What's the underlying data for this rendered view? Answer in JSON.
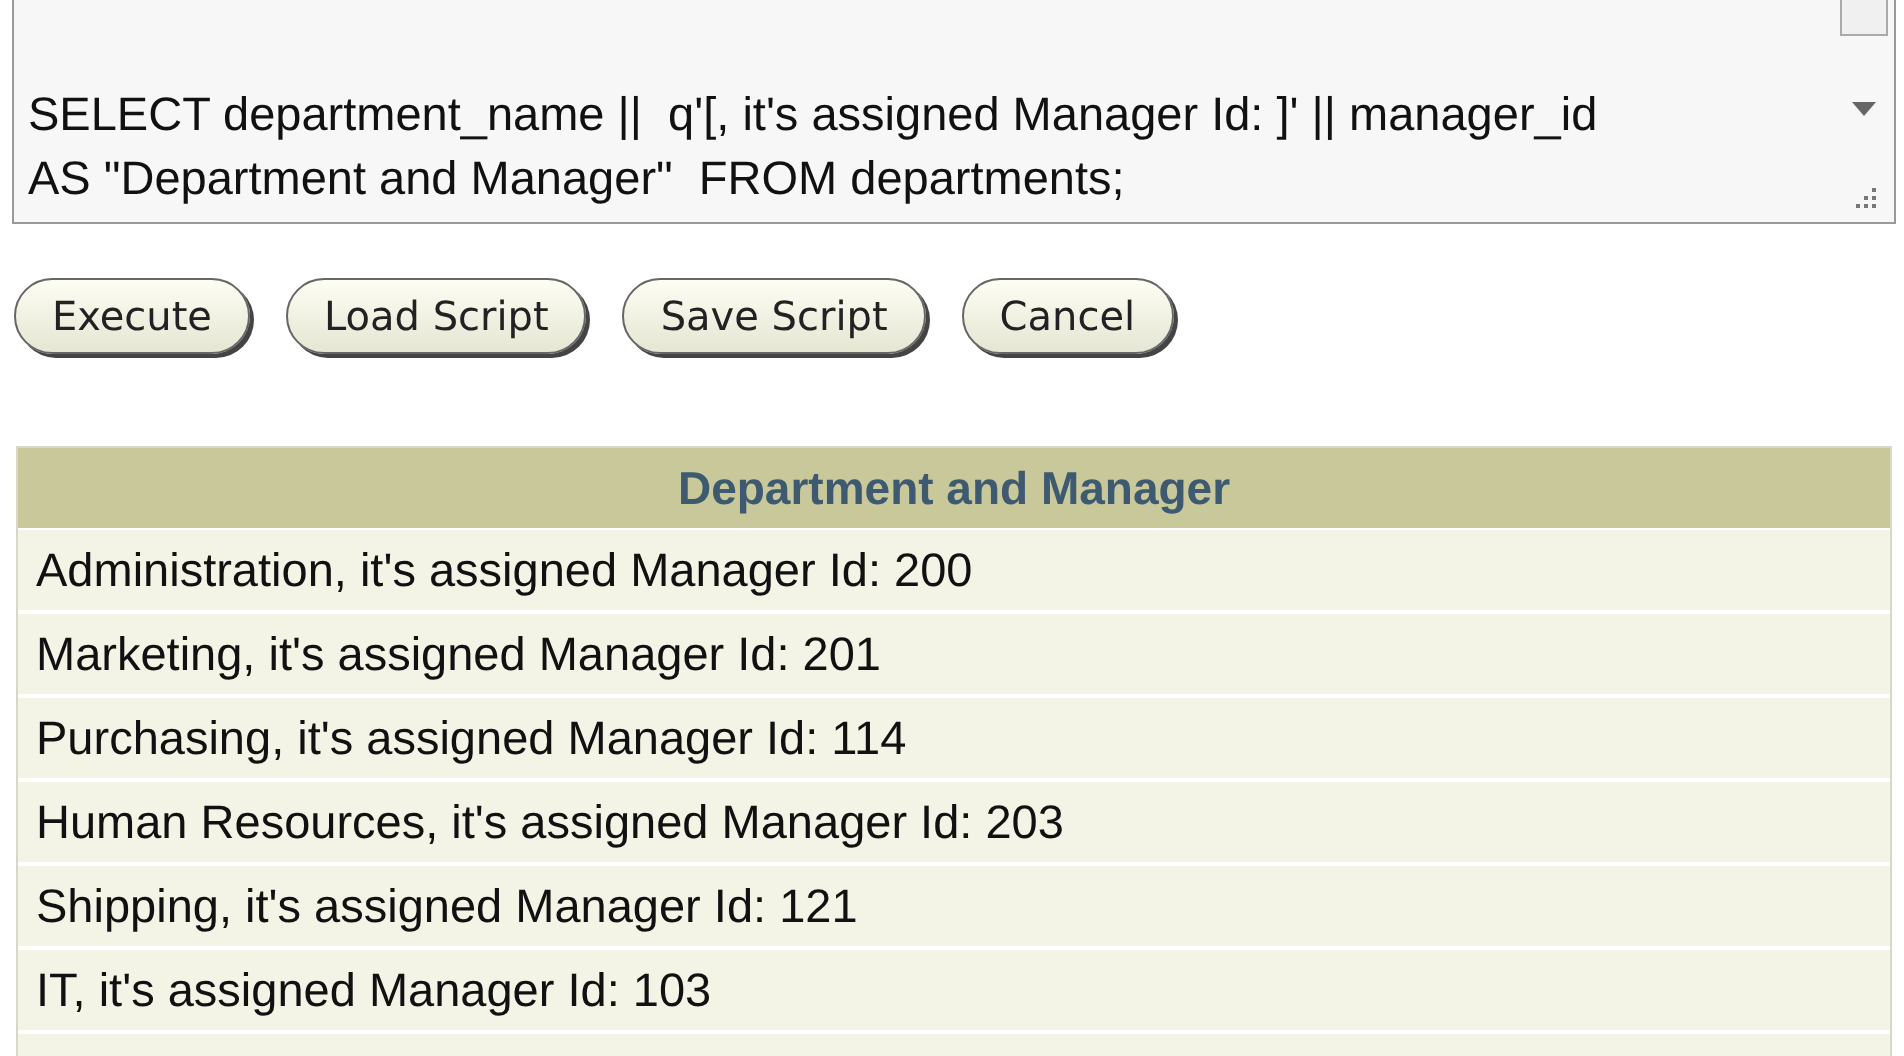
{
  "editor": {
    "lines": [
      "SELECT department_name ||  q'[, it's assigned Manager Id: ]' || manager_id",
      "AS \"Department and Manager\"  FROM departments;"
    ]
  },
  "buttons": [
    "Execute",
    "Load Script",
    "Save Script",
    "Cancel"
  ],
  "table": {
    "columns": [
      "Department and Manager"
    ],
    "rows": [
      "Administration, it's assigned Manager Id: 200",
      "Marketing, it's assigned Manager Id: 201",
      "Purchasing, it's assigned Manager Id: 114",
      "Human Resources, it's assigned Manager Id: 203",
      "Shipping, it's assigned Manager Id: 121",
      "IT, it's assigned Manager Id: 103"
    ]
  }
}
